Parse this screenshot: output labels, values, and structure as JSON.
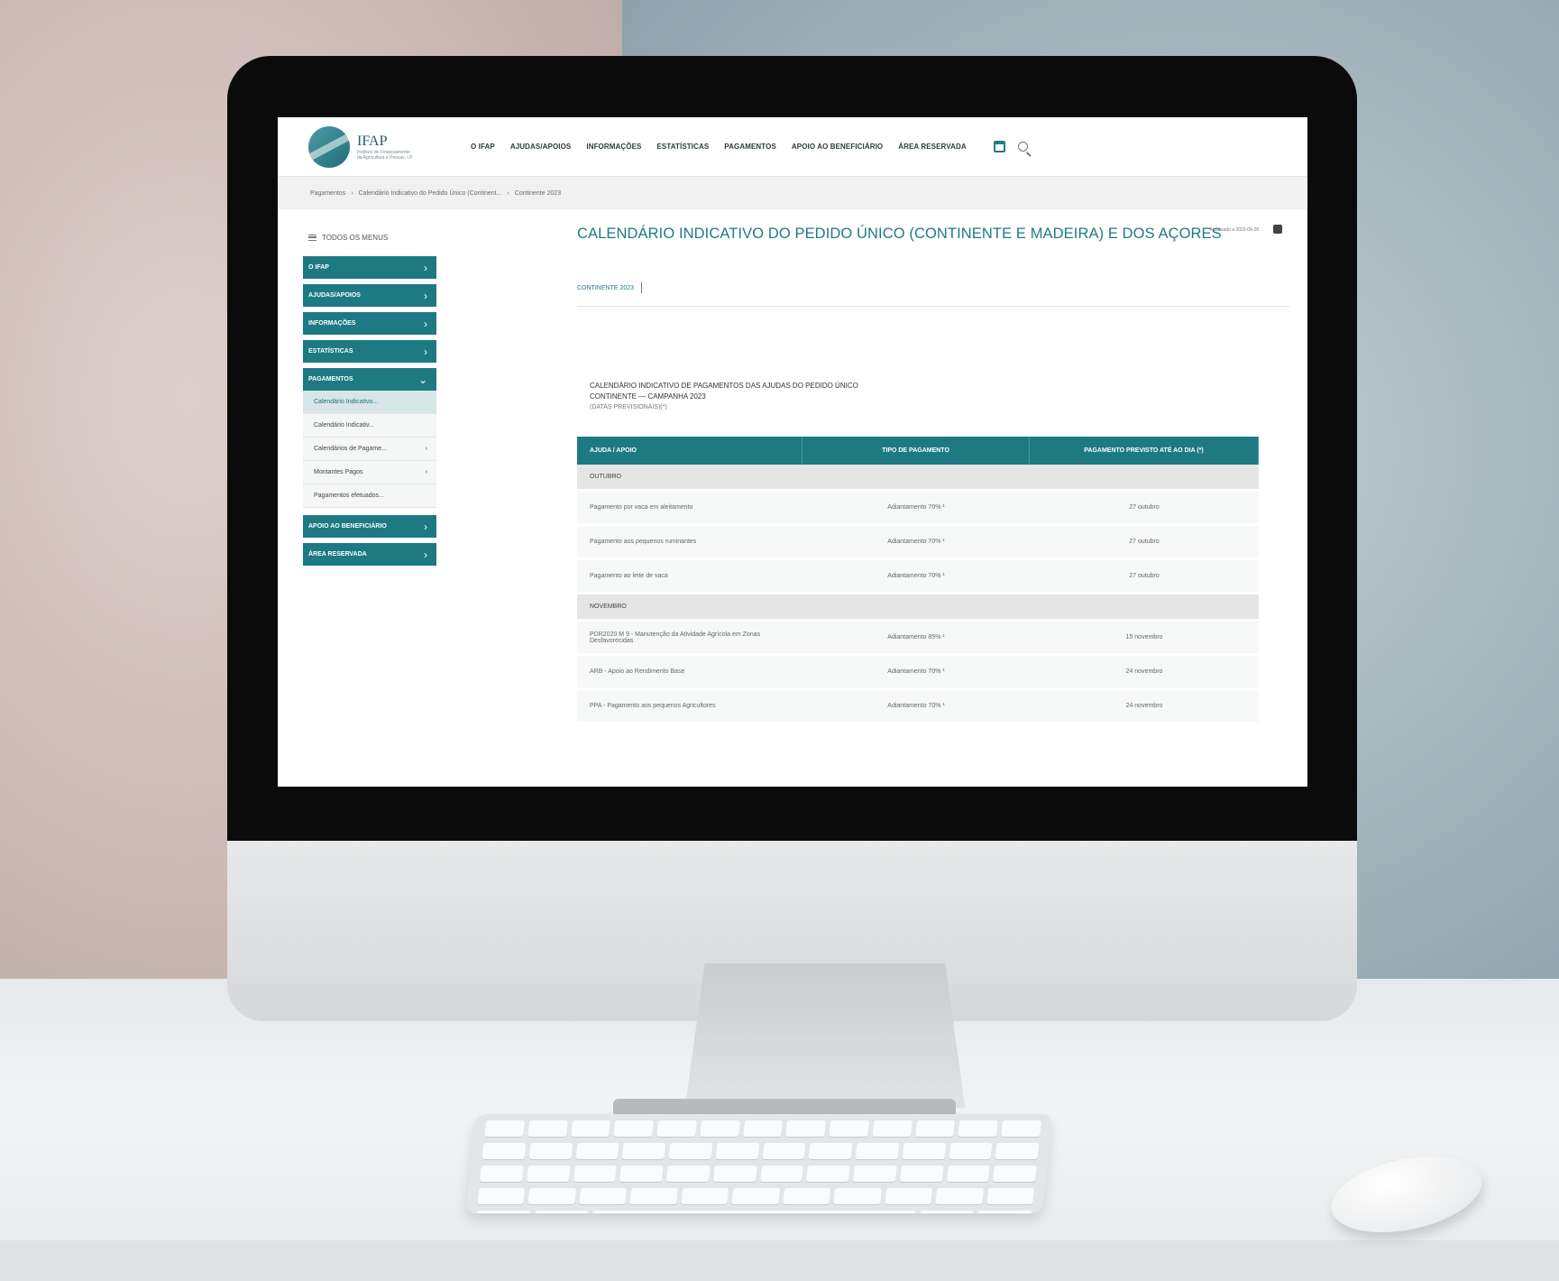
{
  "header": {
    "logo_name": "IFAP",
    "logo_sub1": "Instituto de Financiamento",
    "logo_sub2": "da Agricultura e Pescas, I.P.",
    "nav": [
      "O IFAP",
      "AJUDAS/APOIOS",
      "INFORMAÇÕES",
      "ESTATÍSTICAS",
      "PAGAMENTOS",
      "APOIO AO BENEFICIÁRIO",
      "ÁREA RESERVADA"
    ],
    "icons": [
      "calendar-icon",
      "search-icon"
    ]
  },
  "breadcrumb": [
    "Pagamentos",
    "Calendário Indicativo do Pedido Único (Continent...",
    "Continente 2023"
  ],
  "sidebar": {
    "all_menus": "TODOS OS MENUS",
    "items": [
      "O IFAP",
      "AJUDAS/APOIOS",
      "INFORMAÇÕES",
      "ESTATÍSTICAS",
      "PAGAMENTOS"
    ],
    "subitems": [
      "Calendário Indicativo...",
      "Calendário Indicativ...",
      "Calendários de Pagame...",
      "Montantes Pagos",
      "Pagamentos efetuados..."
    ],
    "items_after": [
      "APOIO AO BENEFICIÁRIO",
      "ÁREA RESERVADA"
    ]
  },
  "main": {
    "title": "CALENDÁRIO INDICATIVO DO PEDIDO ÚNICO (CONTINENTE E MADEIRA) E DOS AÇORES",
    "updated": "Atualizado a 2023-09-28",
    "tab": "CONTINENTE 2023",
    "section_line1": "CALENDÁRIO INDICATIVO DE PAGAMENTOS DAS AJUDAS DO PEDIDO ÚNICO",
    "section_line2": "CONTINENTE — CAMPANHA 2023",
    "section_line3": "(DATAS PREVISIONAIS)(*)"
  },
  "table": {
    "headers": [
      "AJUDA / APOIO",
      "TIPO DE PAGAMENTO",
      "PAGAMENTO PREVISTO ATÉ AO DIA (*)"
    ],
    "months": [
      "OUTUBRO",
      "NOVEMBRO"
    ],
    "outubro": [
      [
        "Pagamento por vaca em aleitamento",
        "Adiantamento 70% ¹",
        "27 outubro"
      ],
      [
        "Pagamento aos pequenos ruminantes",
        "Adiantamento 70% ¹",
        "27 outubro"
      ],
      [
        "Pagamento ao leite de vaca",
        "Adiantamento 70% ¹",
        "27 outubro"
      ]
    ],
    "novembro": [
      [
        "PDR2020 M 9 - Manutenção da Atividade Agrícola em Zonas Desfavorecidas",
        "Adiantamento 85% ¹",
        "15 novembro"
      ],
      [
        "ARB - Apoio ao Rendimento Base",
        "Adiantamento 70% ¹",
        "24 novembro"
      ],
      [
        "PPA - Pagamento aos pequenos Agricultores",
        "Adiantamento 70% ¹",
        "24 novembro"
      ]
    ]
  }
}
